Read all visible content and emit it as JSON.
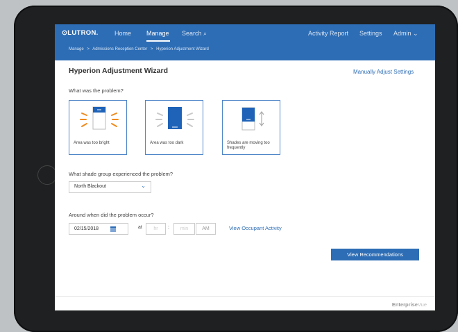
{
  "header": {
    "logo": "⊙LUTRON.",
    "nav": {
      "home": "Home",
      "manage": "Manage",
      "search": "Search ⌕",
      "activity_report": "Activity Report",
      "settings": "Settings",
      "admin": "Admin ⌄"
    },
    "breadcrumb": [
      "Manage",
      "Admissions Reception Center",
      "Hyperion Adjustment Wizard"
    ],
    "breadcrumb_sep": ">"
  },
  "page": {
    "title": "Hyperion Adjustment Wizard",
    "manual_link": "Manually Adjust Settings",
    "q1": "What was the problem?",
    "problems": [
      {
        "label": "Area was too bright",
        "icon": "bright-window-icon"
      },
      {
        "label": "Area was too dark",
        "icon": "dark-window-icon"
      },
      {
        "label": "Shades are moving too frequently",
        "icon": "moving-shade-icon"
      }
    ],
    "q2": "What shade group experienced the problem?",
    "shade_group": "North Blackout",
    "q3": "Around when did the problem occur?",
    "date": "02/15/2018",
    "at": "at",
    "hour_placeholder": "hr",
    "colon": ":",
    "min_placeholder": "min",
    "ampm": "AM",
    "occupant_link": "View Occupant Activity",
    "recommend_button": "View Recommendations"
  },
  "footer": {
    "brand_1": "Enterprise",
    "brand_2": "Vue"
  },
  "colors": {
    "accent": "#2d6db5",
    "sun": "#f08a1c"
  }
}
